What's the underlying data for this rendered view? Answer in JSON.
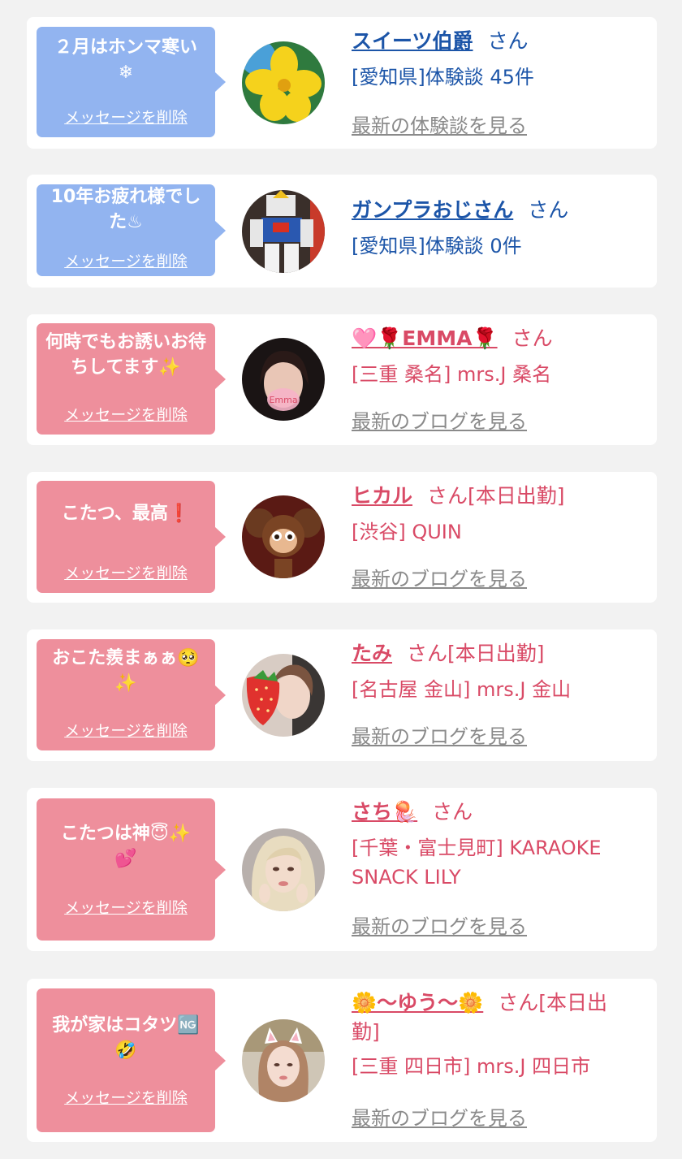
{
  "delete_label": "メッセージを削除",
  "suffix": "さん",
  "entries": [
    {
      "message": "２月はホンマ寒い\n❄",
      "name": "スイーツ伯爵",
      "status": "",
      "detail": "[愛知県]体験談 45件",
      "link": "最新の体験談を見る",
      "bubble_color": "#92b4f0",
      "text_color": "#1c55a8",
      "avatar": "yellow-flower-avatar"
    },
    {
      "message": "10年お疲れ様でした♨",
      "name": "ガンプラおじさん",
      "status": "",
      "detail": "[愛知県]体験談 0件",
      "link": "",
      "bubble_color": "#92b4f0",
      "text_color": "#1c55a8",
      "avatar": "robot-model-avatar"
    },
    {
      "message": "何時でもお誘いお待ちしてます✨",
      "name": "🩷🌹EMMA🌹",
      "status": "",
      "detail": "[三重 桑名] mrs.J 桑名",
      "link": "最新のブログを見る",
      "bubble_color": "#ee8f9c",
      "text_color": "#d94a66",
      "avatar": "woman-portrait-avatar"
    },
    {
      "message": "こたつ、最高❗",
      "name": "ヒカル",
      "status": "[本日出勤]",
      "detail": "[渋谷] QUIN",
      "link": "最新のブログを見る",
      "bubble_color": "#ee8f9c",
      "text_color": "#d94a66",
      "avatar": "plush-toy-avatar"
    },
    {
      "message": "おこた羨まぁぁ🥺\n✨",
      "name": "たみ",
      "status": "[本日出勤]",
      "detail": "[名古屋 金山] mrs.J 金山",
      "link": "最新のブログを見る",
      "bubble_color": "#ee8f9c",
      "text_color": "#d94a66",
      "avatar": "strawberry-woman-avatar"
    },
    {
      "message": "こたつは神😇✨\n💕",
      "name": "さち🪼",
      "status": "",
      "detail": "[千葉・富士見町] KARAOKE SNACK LILY",
      "link": "最新のブログを見る",
      "bubble_color": "#ee8f9c",
      "text_color": "#d94a66",
      "avatar": "blonde-woman-avatar"
    },
    {
      "message": "我が家はコタツ🆖\n🤣",
      "name": "🌼〜ゆう〜🌼",
      "status": "[本日出勤]",
      "detail": "[三重 四日市] mrs.J 四日市",
      "link": "最新のブログを見る",
      "bubble_color": "#ee8f9c",
      "text_color": "#d94a66",
      "avatar": "cat-ears-woman-avatar"
    }
  ]
}
